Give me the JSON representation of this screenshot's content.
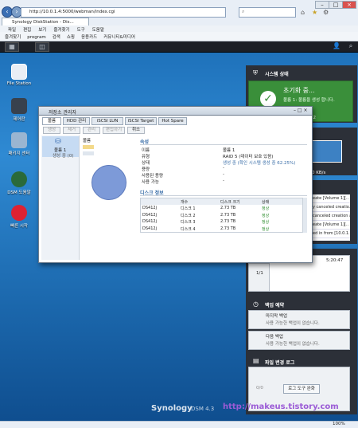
{
  "browser": {
    "address": "http://10.0.1.4:5000/webman/index.cgi",
    "tab_title": "Synology DiskStation - Dis...",
    "menu": [
      "파일",
      "편집",
      "보기",
      "즐겨찾기",
      "도구",
      "도움말"
    ],
    "favorites": [
      "즐겨찾기",
      "program",
      "검색",
      "쇼핑",
      "응용카드",
      "커뮤니티&미디어"
    ],
    "zoom": "100%"
  },
  "desktop": {
    "icons": [
      "File Station",
      "제어판",
      "패키지 센터",
      "DSM 도움말",
      "빠른 시작"
    ],
    "logo": "Synology",
    "logo_sub": "DSM 4.3",
    "watermark": "http://makeus.tistory.com"
  },
  "widgets": {
    "system_title": "시스템 상태",
    "system_status": "초기화 중...",
    "system_sub": "볼륨 1: 볼륨을 생성 합니다.",
    "system_extra": "02",
    "net_speed": "0 KB/s",
    "logs": [
      "eate [Volume 1][..",
      "y canceled creatio..",
      "canceled creation a..",
      "eate [Volume 1][..",
      "ed in from [10.0.1.."
    ],
    "time": "5:20:47",
    "page": "1/1",
    "backup_title": "백업 예약",
    "backup_items": [
      {
        "name": "마지막 백업",
        "desc": "사용 가능한 백업이 없습니다."
      },
      {
        "name": "다음 백업",
        "desc": "사용 가능한 백업이 없습니다."
      }
    ],
    "log_title": "파일 변경 로그",
    "log_page": "0/0",
    "log_button": "로그 도구 완화"
  },
  "dialog": {
    "title": "저장소 관리자",
    "tabs": [
      "볼륨",
      "HDD 관리",
      "iSCSI LUN",
      "iSCSI Target",
      "Hot Spare"
    ],
    "toolbar": [
      "생성",
      "제거",
      "관리",
      "편집하기",
      "취소"
    ],
    "left_item": "볼륨 1",
    "left_sub": "생성 중 (0)",
    "legend": "볼륨",
    "prop_title": "속성",
    "props": [
      [
        "이름",
        "볼륨 1"
      ],
      [
        "유형",
        "RAID 5 (데이터 보호 있음)"
      ],
      [
        "상태",
        "생성 중 (확인 시스템 생성 중 62.25%)"
      ],
      [
        "용량",
        "-"
      ],
      [
        "사용된 용량",
        "-"
      ],
      [
        "사용 가능",
        "-"
      ]
    ],
    "disk_title": "디스크 정보",
    "disk_headers": [
      "",
      "개수",
      "디스크 크기",
      "상태"
    ],
    "disks": [
      [
        "DS412j",
        "디스크 1",
        "2.73 TB",
        "정상"
      ],
      [
        "DS412j",
        "디스크 2",
        "2.73 TB",
        "정상"
      ],
      [
        "DS412j",
        "디스크 3",
        "2.73 TB",
        "정상"
      ],
      [
        "DS412j",
        "디스크 4",
        "2.73 TB",
        "정상"
      ]
    ]
  },
  "colors": {
    "accent": "#3a6ea8",
    "ok": "#2c8c2c",
    "desktop": "#1d6fb8"
  }
}
